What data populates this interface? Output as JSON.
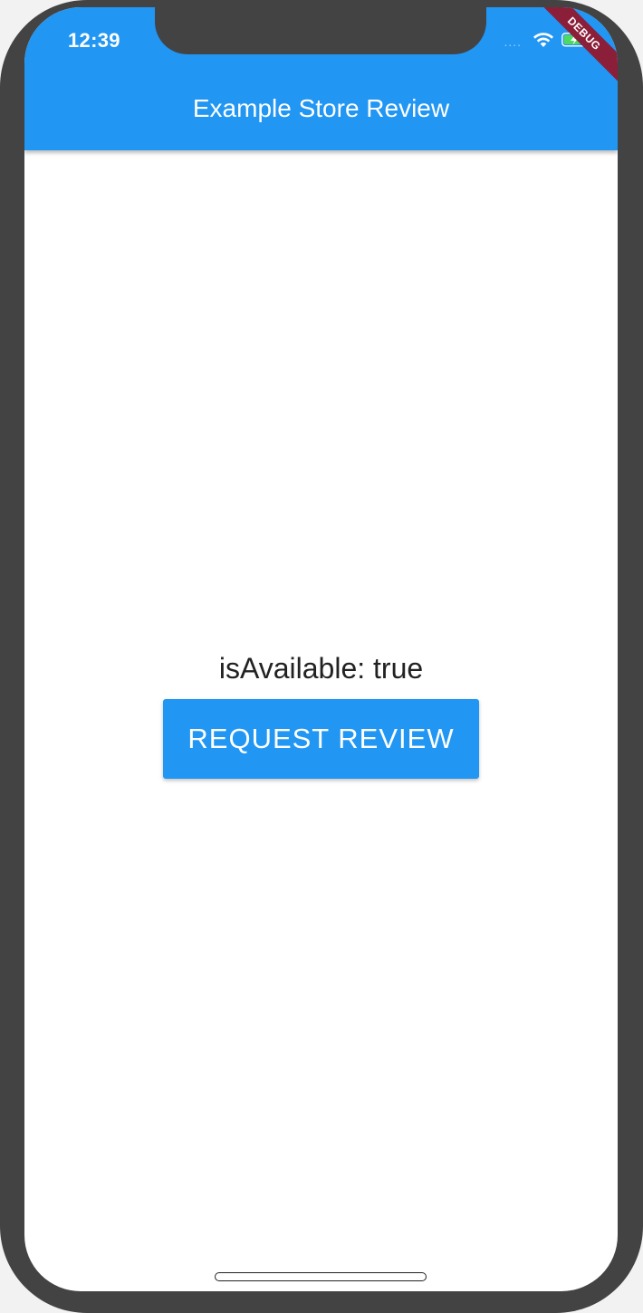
{
  "colors": {
    "accent": "#2196F3",
    "debug_banner": "#8B1F3A",
    "device_frame": "#434343"
  },
  "status_bar": {
    "time": "12:39",
    "icons": [
      "wifi-icon",
      "battery-charging-icon"
    ]
  },
  "debug_banner": {
    "label": "DEBUG"
  },
  "app_bar": {
    "title": "Example Store Review"
  },
  "main": {
    "availability_text": "isAvailable: true",
    "request_review_label": "REQUEST REVIEW"
  }
}
